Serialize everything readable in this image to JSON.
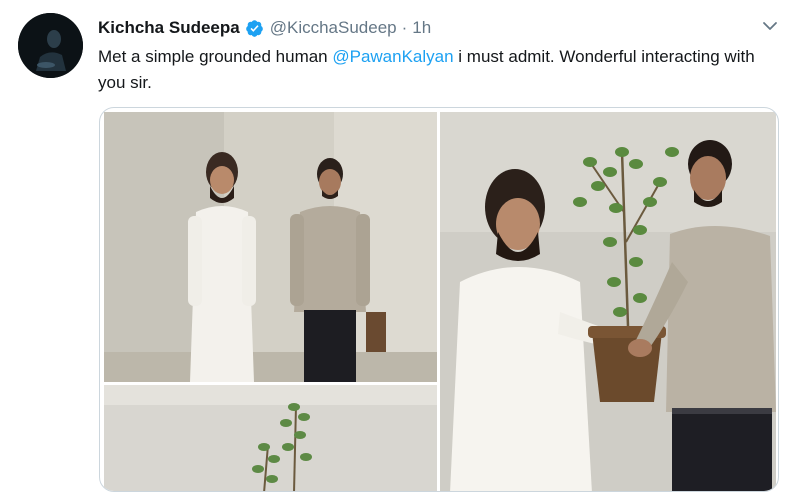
{
  "tweet": {
    "author_name": "Kichcha Sudeepa",
    "handle": "@KicchaSudeep",
    "separator": "·",
    "time": "1h",
    "text_before_mention": "Met a simple grounded human ",
    "mention": "@PawanKalyan",
    "text_after_mention": " i must admit. Wonderful interacting with you sir."
  },
  "icons": {
    "verified": "verified-badge-icon",
    "more": "chevron-down-icon"
  },
  "colors": {
    "link": "#1da1f2",
    "secondary_text": "#657786",
    "primary_text": "#14171a",
    "avatar_bg": "#0c1216"
  }
}
